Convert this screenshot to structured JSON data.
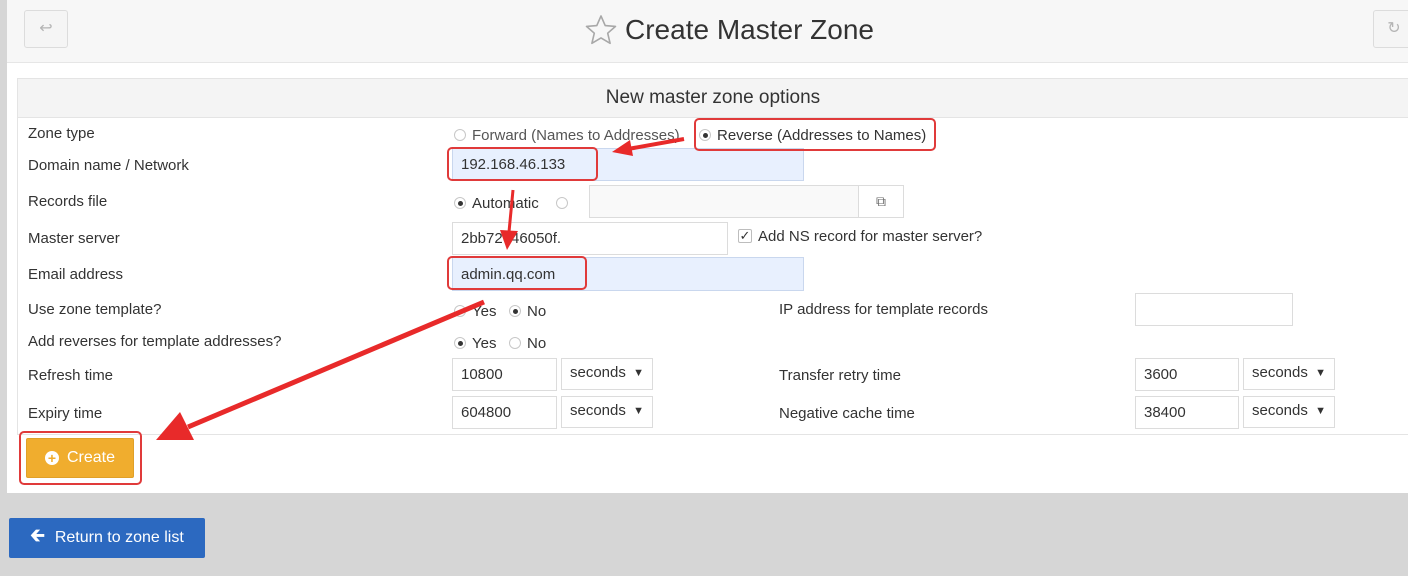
{
  "header": {
    "title": "Create Master Zone",
    "back_icon": "return-arrow-icon",
    "refresh_icon": "refresh-icon"
  },
  "form": {
    "section_title": "New master zone options",
    "zone_type": {
      "label": "Zone type",
      "options": [
        "Forward (Names to Addresses)",
        "Reverse (Addresses to Names)"
      ],
      "selected": "Reverse (Addresses to Names)"
    },
    "domain": {
      "label": "Domain name / Network",
      "value": "192.168.46.133"
    },
    "records_file": {
      "label": "Records file",
      "option_automatic": "Automatic",
      "selected": "Automatic"
    },
    "master_server": {
      "label": "Master server",
      "value": "2bb72646050f.",
      "add_ns_label": "Add NS record for master server?",
      "add_ns_checked": true
    },
    "email": {
      "label": "Email address",
      "value": "admin.qq.com"
    },
    "use_template": {
      "label": "Use zone template?",
      "yes": "Yes",
      "no": "No",
      "selected": "No"
    },
    "template_ip": {
      "label": "IP address for template records",
      "value": ""
    },
    "add_reverses": {
      "label": "Add reverses for template addresses?",
      "yes": "Yes",
      "no": "No",
      "selected": "Yes"
    },
    "refresh": {
      "label": "Refresh time",
      "value": "10800",
      "unit": "seconds"
    },
    "transfer_retry": {
      "label": "Transfer retry time",
      "value": "3600",
      "unit": "seconds"
    },
    "expiry": {
      "label": "Expiry time",
      "value": "604800",
      "unit": "seconds"
    },
    "negative_cache": {
      "label": "Negative cache time",
      "value": "38400",
      "unit": "seconds"
    }
  },
  "buttons": {
    "create": "Create",
    "return": "Return to zone list"
  },
  "colors": {
    "create_button": "#f0ad2e",
    "return_button": "#2c69c0",
    "annotation": "#e03a3a"
  }
}
